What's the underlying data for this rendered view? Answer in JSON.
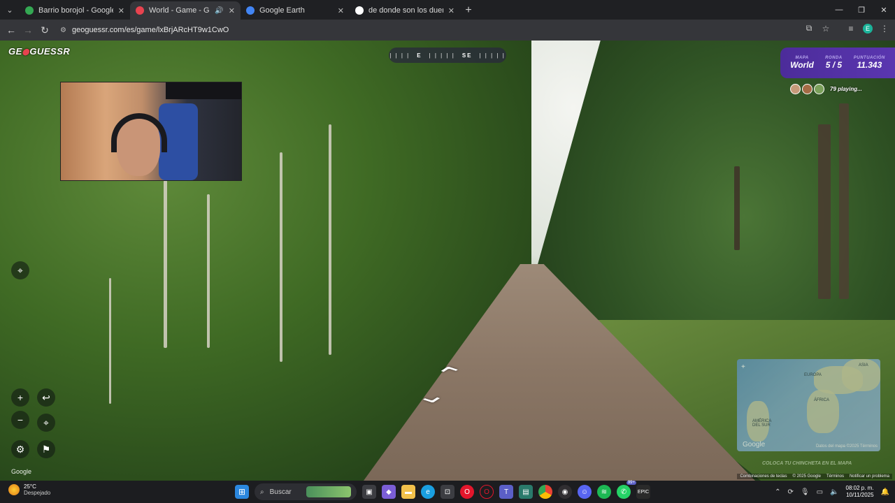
{
  "browser": {
    "tabs": [
      {
        "title": "Barrio borojol - Google Maps",
        "favicon_color": "#34a853",
        "active": false,
        "audio": false
      },
      {
        "title": "World - Game - GeoGuessr",
        "favicon_color": "#e8434f",
        "active": true,
        "audio": true
      },
      {
        "title": "Google Earth",
        "favicon_color": "#4285f4",
        "active": false,
        "audio": false
      },
      {
        "title": "de donde son los duendes - Bu",
        "favicon_color": "#ffffff",
        "active": false,
        "audio": false
      }
    ],
    "new_tab_symbol": "+",
    "url": "geoguessr.com/es/game/lxBrjARcHT9w1CwO",
    "profile_initial": "E",
    "window_controls": {
      "minimize": "—",
      "restore": "❐",
      "close": "✕"
    }
  },
  "game": {
    "logo_text_1": "GE",
    "logo_pin": "⬤",
    "logo_text_2": "GUESSR",
    "compass": {
      "left_tick": "| | | |",
      "e": "E",
      "mid_tick": "| | | | |",
      "se": "SE",
      "right_tick": "| | | | |"
    },
    "hud": {
      "map_label": "MAPA",
      "map_value": "World",
      "round_label": "RONDA",
      "round_value": "5 / 5",
      "score_label": "PUNTUACIÓN",
      "score_value": "11.343"
    },
    "players_text": "79 playing...",
    "minimap": {
      "labels": [
        "EUROPA",
        "ASIA",
        "ÁFRICA",
        "AMÉRICA DEL SUR"
      ],
      "google": "Google",
      "attribution": "Datos del mapa ©2025   Términos"
    },
    "place_hint": "COLOCA TU CHINCHETA EN EL MAPA",
    "google_mark": "Google",
    "footer": [
      "Combinaciones de teclas",
      "© 2025 Google",
      "Términos",
      "Notificar un problema"
    ]
  },
  "taskbar": {
    "weather_temp": "25°C",
    "weather_desc": "Despejado",
    "search_placeholder": "Buscar",
    "time": "08:02 p. m.",
    "date": "10/11/2025",
    "badge": "99+"
  }
}
